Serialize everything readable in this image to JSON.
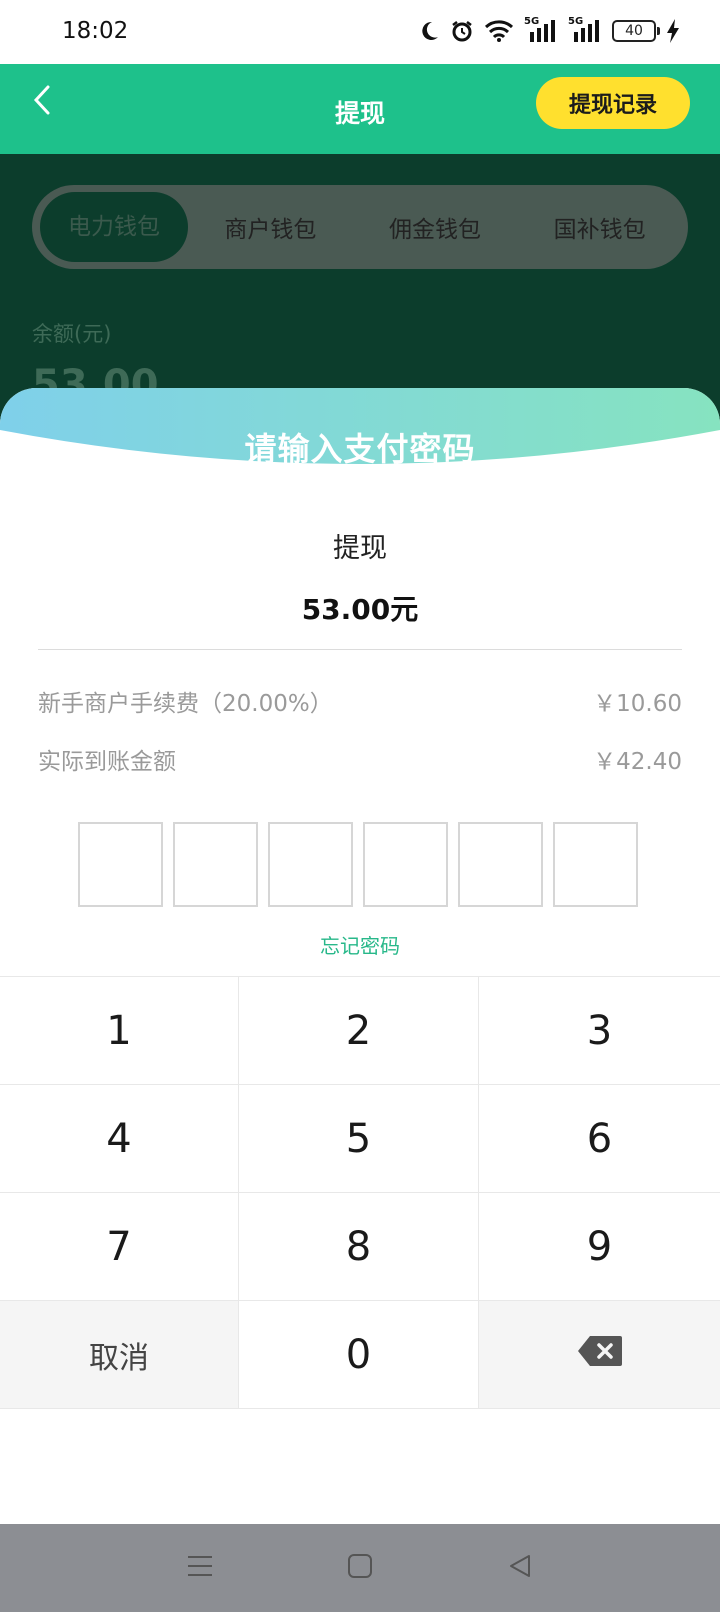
{
  "status_bar": {
    "time": "18:02",
    "network_1": "5G",
    "network_2": "5G",
    "battery": "40",
    "icons": [
      "moon-icon",
      "alarm-icon",
      "wifi-icon",
      "signal-icon",
      "signal-icon",
      "battery-icon",
      "charging-icon"
    ]
  },
  "header": {
    "title": "提现",
    "records_label": "提现记录",
    "back_icon": "chevron-left-icon"
  },
  "wallet_tabs": [
    {
      "label": "电力钱包",
      "active": true
    },
    {
      "label": "商户钱包",
      "active": false
    },
    {
      "label": "佣金钱包",
      "active": false
    },
    {
      "label": "国补钱包",
      "active": false
    }
  ],
  "balance": {
    "label": "余额(元)",
    "value": "53.00"
  },
  "sheet": {
    "title": "请输入支付密码",
    "withdraw_label": "提现",
    "withdraw_amount": "53.00元",
    "fee_label": "新手商户手续费（20.00%）",
    "fee_value": "￥10.60",
    "actual_label": "实际到账金额",
    "actual_value": "￥42.40",
    "pin_length": 6,
    "forgot_label": "忘记密码"
  },
  "keypad": {
    "keys": [
      "1",
      "2",
      "3",
      "4",
      "5",
      "6",
      "7",
      "8",
      "9"
    ],
    "cancel_label": "取消",
    "zero_label": "0",
    "delete_icon": "backspace-icon"
  },
  "colors": {
    "header_green": "#1ec18b",
    "records_yellow": "#ffe02e",
    "link_green": "#28b88a",
    "banner_start": "#7fd0ea",
    "banner_end": "#86e3c0"
  },
  "nav_bar": {
    "icons": [
      "menu-icon",
      "home-icon",
      "back-triangle-icon"
    ]
  }
}
